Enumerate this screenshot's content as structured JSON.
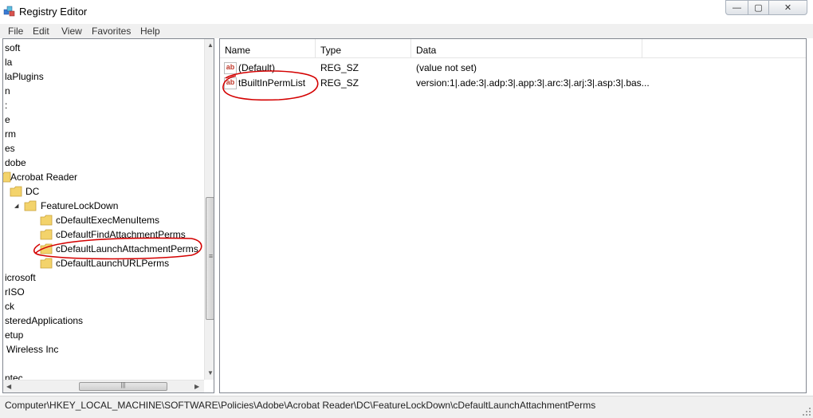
{
  "window": {
    "title": "Registry Editor",
    "icon": "registry-editor-icon",
    "controls": {
      "minimize": "—",
      "maximize": "▢",
      "close": "✕"
    }
  },
  "menu": [
    "File",
    "Edit",
    "View",
    "Favorites",
    "Help"
  ],
  "tree": {
    "rows": [
      {
        "label": "soft",
        "expander": ""
      },
      {
        "label": "la",
        "expander": ""
      },
      {
        "label": "laPlugins",
        "expander": ""
      },
      {
        "label": "n",
        "expander": ""
      },
      {
        "label": ":",
        "expander": ""
      },
      {
        "label": "e",
        "expander": ""
      },
      {
        "label": "rm",
        "expander": ""
      },
      {
        "label": "es",
        "expander": ""
      },
      {
        "label": "dobe",
        "expander": ""
      },
      {
        "label": "Acrobat Reader",
        "expander": ""
      },
      {
        "label": "DC",
        "expander": ""
      },
      {
        "label": "FeatureLockDown",
        "expander": "◢"
      },
      {
        "label": "cDefaultExecMenuItems",
        "expander": ""
      },
      {
        "label": "cDefaultFindAttachmentPerms",
        "expander": ""
      },
      {
        "label": "cDefaultLaunchAttachmentPerms",
        "expander": ""
      },
      {
        "label": "cDefaultLaunchURLPerms",
        "expander": ""
      },
      {
        "label": "icrosoft",
        "expander": ""
      },
      {
        "label": "rISO",
        "expander": ""
      },
      {
        "label": "ck",
        "expander": ""
      },
      {
        "label": "steredApplications",
        "expander": ""
      },
      {
        "label": "etup",
        "expander": ""
      },
      {
        "label": "Wireless Inc",
        "expander": ""
      },
      {
        "label": "",
        "expander": ""
      },
      {
        "label": "ntec",
        "expander": ""
      }
    ],
    "scrollbar": {
      "up": "▲",
      "down": "▼",
      "left": "◀",
      "right": "▶",
      "grip": "≡",
      "hgrip": "|||"
    }
  },
  "list": {
    "columns": [
      "Name",
      "Type",
      "Data"
    ],
    "rows": [
      {
        "icon": "ab",
        "name": "(Default)",
        "type": "REG_SZ",
        "data": "(value not set)"
      },
      {
        "icon": "ab",
        "name": "tBuiltInPermList",
        "type": "REG_SZ",
        "data": "version:1|.ade:3|.adp:3|.app:3|.arc:3|.arj:3|.asp:3|.bas..."
      }
    ]
  },
  "status": {
    "path": "Computer\\HKEY_LOCAL_MACHINE\\SOFTWARE\\Policies\\Adobe\\Acrobat Reader\\DC\\FeatureLockDown\\cDefaultLaunchAttachmentPerms"
  },
  "colors": {
    "annotation": "#d40000",
    "folder": "#f3d36b",
    "chrome": "#f0f0f0"
  }
}
